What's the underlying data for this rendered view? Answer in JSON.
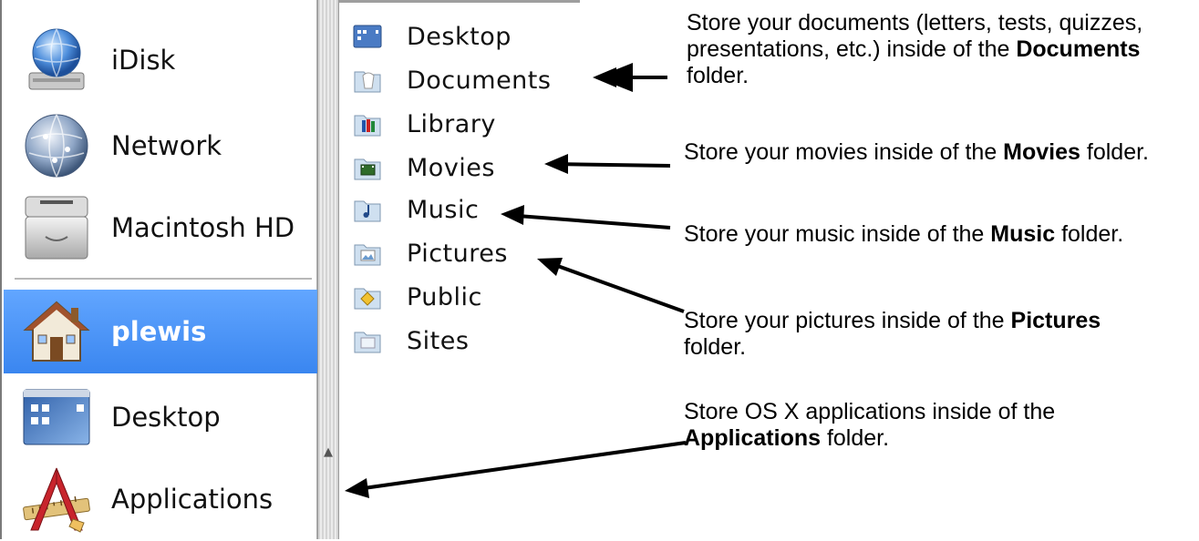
{
  "sidebar": {
    "items": [
      {
        "label": "iDisk",
        "icon": "idisk-icon"
      },
      {
        "label": "Network",
        "icon": "network-icon"
      },
      {
        "label": "Macintosh HD",
        "icon": "hard-drive-icon"
      },
      {
        "label": "plewis",
        "icon": "home-icon"
      },
      {
        "label": "Desktop",
        "icon": "desktop-icon"
      },
      {
        "label": "Applications",
        "icon": "applications-icon"
      }
    ]
  },
  "column": {
    "items": [
      {
        "label": "Desktop",
        "icon": "desktop-folder-icon"
      },
      {
        "label": "Documents",
        "icon": "documents-folder-icon"
      },
      {
        "label": "Library",
        "icon": "library-folder-icon"
      },
      {
        "label": "Movies",
        "icon": "movies-folder-icon"
      },
      {
        "label": "Music",
        "icon": "music-folder-icon"
      },
      {
        "label": "Pictures",
        "icon": "pictures-folder-icon"
      },
      {
        "label": "Public",
        "icon": "public-folder-icon"
      },
      {
        "label": "Sites",
        "icon": "sites-folder-icon"
      }
    ]
  },
  "annotations": {
    "documents": {
      "pre": " Store your documents (letters, tests, quizzes, presentations, etc.) inside of the ",
      "bold": "Documents",
      "post": " folder."
    },
    "movies": {
      "pre": "Store your movies inside of the ",
      "bold": "Movies",
      "post": " folder."
    },
    "music": {
      "pre": "Store your music inside of the ",
      "bold": "Music",
      "post": " folder."
    },
    "pictures": {
      "pre": "Store your pictures inside of the ",
      "bold": "Pictures",
      "post": " folder."
    },
    "applications": {
      "pre": "Store OS X applications inside of the ",
      "bold": "Applications",
      "post": " folder."
    }
  },
  "colors": {
    "selection": "#3a86f0",
    "arrow": "#000000"
  }
}
